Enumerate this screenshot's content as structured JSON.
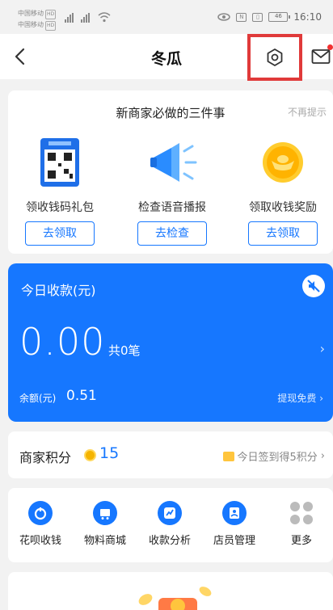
{
  "status_bar": {
    "carrier1": "中国移动",
    "carrier2": "中国移动",
    "network_tag": "HD",
    "battery": "46",
    "time": "16:10"
  },
  "nav": {
    "title": "冬瓜",
    "back_icon": "chevron-left-icon",
    "settings_icon": "gear-icon",
    "mail_icon": "mail-icon"
  },
  "onboarding": {
    "title": "新商家必做的三件事",
    "dismiss": "不再提示",
    "tasks": [
      {
        "label": "领收钱码礼包",
        "button": "去领取",
        "icon": "qr-code-package-icon"
      },
      {
        "label": "检查语音播报",
        "button": "去检查",
        "icon": "megaphone-icon"
      },
      {
        "label": "领取收钱奖励",
        "button": "去领取",
        "icon": "gold-ingot-icon"
      }
    ]
  },
  "income": {
    "title": "今日收款(元)",
    "amount": "0.00",
    "count": "共0笔",
    "balance_label": "余额(元)",
    "balance": "0.51",
    "withdraw": "提现免费",
    "colors": {
      "card": "#1677ff"
    }
  },
  "points": {
    "label": "商家积分",
    "value": "15",
    "checkin": "今日签到得5积分"
  },
  "shortcuts": [
    {
      "label": "花呗收钱",
      "icon": "huabei-icon"
    },
    {
      "label": "物料商城",
      "icon": "shopping-cart-icon"
    },
    {
      "label": "收款分析",
      "icon": "chart-icon"
    },
    {
      "label": "店员管理",
      "icon": "staff-icon"
    },
    {
      "label": "更多",
      "icon": "more-grid-icon"
    }
  ]
}
